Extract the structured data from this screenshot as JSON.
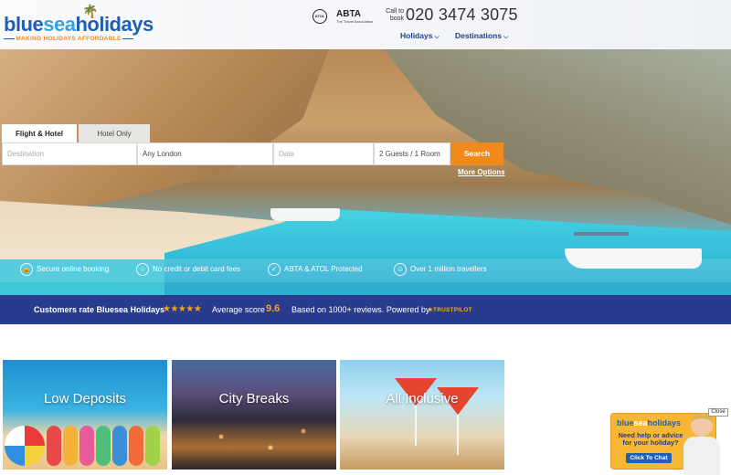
{
  "header": {
    "logo": {
      "part1": "blue",
      "part2": "sea",
      "part3": "holidays",
      "tagline": "MAKING HOLIDAYS AFFORDABLE"
    },
    "atol_badge": "ATOL",
    "abta": {
      "name": "ABTA",
      "sub": "The Travel Association"
    },
    "call_label": "Call to book",
    "phone": "020 3474 3075",
    "nav": [
      {
        "label": "Holidays"
      },
      {
        "label": "Destinations"
      }
    ]
  },
  "search": {
    "tabs": [
      {
        "label": "Flight & Hotel",
        "active": true
      },
      {
        "label": "Hotel Only",
        "active": false
      }
    ],
    "destination_placeholder": "Destination",
    "departure_value": "Any London",
    "date_placeholder": "Date",
    "guests_value": "2 Guests / 1 Room",
    "search_label": "Search",
    "more_options": "More Options"
  },
  "usps": [
    {
      "label": "Secure online booking",
      "icon": "lock-icon"
    },
    {
      "label": "No credit or debit card fees",
      "icon": "star-icon"
    },
    {
      "label": "ABTA & ATOL Protected",
      "icon": "check-icon"
    },
    {
      "label": "Over 1 million travellers",
      "icon": "person-icon"
    }
  ],
  "rating": {
    "lead": "Customers rate Bluesea Holidays",
    "stars": "★★★★★",
    "avg_label": "Average score",
    "score": "9.6",
    "reviews": "Based on 1000+ reviews. Powered by",
    "provider": "★TRUSTPILOT"
  },
  "cards": [
    {
      "title": "Low Deposits"
    },
    {
      "title": "City Breaks"
    },
    {
      "title": "All Inclusive"
    }
  ],
  "chat": {
    "close": "Close",
    "logo": {
      "part1": "blue",
      "part2": "sea",
      "part3": "holidays"
    },
    "text": "Need help or advice for your holiday?",
    "button": "Click To Chat"
  },
  "colors": {
    "brand_blue": "#1e5fb4",
    "accent_orange": "#f08a1c",
    "rating_bar": "#283b8c"
  }
}
